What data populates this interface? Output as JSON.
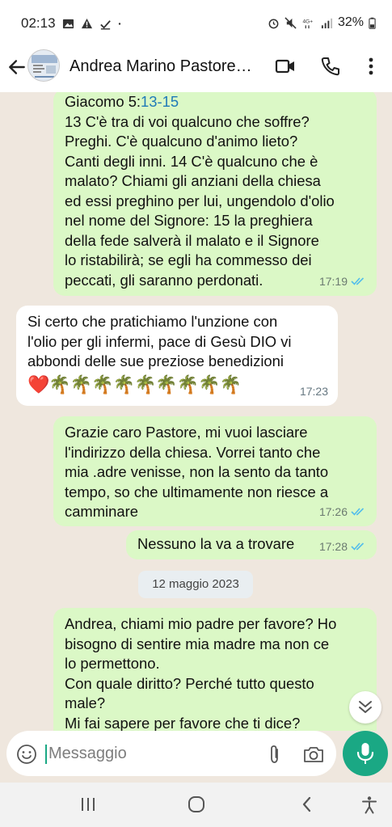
{
  "status_bar": {
    "time": "02:13",
    "battery": "32%",
    "icons": [
      "image-icon",
      "warning-icon",
      "download-icon",
      "dot-icon",
      "alarm-icon",
      "mute-icon",
      "network-4g-icon",
      "signal-icon",
      "battery-icon"
    ]
  },
  "header": {
    "contact_name": "Andrea Marino Pastore…",
    "icons": [
      "back-arrow-icon",
      "avatar",
      "video-call-icon",
      "phone-icon",
      "more-vert-icon"
    ]
  },
  "messages": [
    {
      "direction": "out",
      "ref_prefix": "Giacomo 5:",
      "ref_link": "13-15",
      "lines": [
        "13  C'è tra di voi qualcuno che soffre?",
        "Preghi. C'è qualcuno d'animo lieto?",
        "Canti degli inni. 14  C'è qualcuno che è",
        "malato? Chiami gli anziani della chiesa",
        "ed essi preghino per lui, ungendolo d'olio",
        "nel nome del Signore: 15  la preghiera",
        "della fede salverà il malato e il Signore",
        "lo ristabilirà; se egli ha commesso dei",
        "peccati, gli saranno perdonati."
      ],
      "time": "17:19",
      "read": true
    },
    {
      "direction": "in",
      "lines": [
        "Si certo che pratichiamo l'unzione con",
        "l'olio per gli infermi, pace di Gesù DIO vi",
        "abbondi delle sue preziose benedizioni",
        "❤️🌴🌴🌴🌴🌴🌴🌴🌴🌴"
      ],
      "time": "17:23"
    },
    {
      "direction": "out",
      "lines": [
        "Grazie caro Pastore, mi vuoi lasciare",
        "l'indirizzo della chiesa. Vorrei tanto che",
        "mia .adre venisse, non la sento da tanto",
        "tempo, so che ultimamente non riesce a",
        "camminare"
      ],
      "time": "17:26",
      "read": true
    },
    {
      "direction": "out",
      "lines": [
        "Nessuno la va a trovare"
      ],
      "time": "17:28",
      "read": true
    },
    {
      "direction": "out",
      "lines": [
        "Andrea, chiami mio padre per favore? Ho",
        "bisogno di sentire mia madre ma non ce",
        "lo permettono.",
        "Con quale diritto? Perché tutto questo",
        "male?",
        "Mi fai sapere per favore che ti dice?"
      ]
    }
  ],
  "date_divider": "12 maggio 2023",
  "composer": {
    "placeholder": "Messaggio",
    "icons": [
      "emoji-icon",
      "attach-icon",
      "camera-icon",
      "mic-icon"
    ]
  },
  "colors": {
    "outgoing_bubble": "#dbf8c6",
    "incoming_bubble": "#ffffff",
    "accent": "#1aa884",
    "read_ticks": "#53bdeb",
    "link": "#1f7ab8"
  }
}
